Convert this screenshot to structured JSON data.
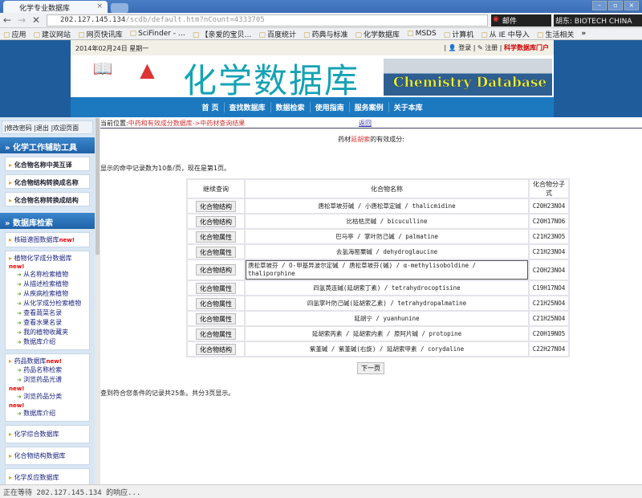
{
  "browser": {
    "tab_title": "化学专业数据库",
    "url_host": "202.127.145.134",
    "url_path": "/scdb/default.htm?nCount=4333705",
    "ext1": "邮件",
    "ext2": "胡东: BIOTECH CHINA",
    "bookmarks": [
      "应用",
      "建议网站",
      "网页快讯库",
      "SciFinder - …",
      "【亲爱的宝贝…",
      "百度统计",
      "药典与标准",
      "化学数据库",
      "MSDS",
      "计算机",
      "从 IE 中导入",
      "生活相关"
    ],
    "more": "»"
  },
  "header": {
    "date": "2014年02月24日 星期一",
    "login": "登录",
    "register": "注册",
    "portal": "科学数据库门户",
    "title": "化学数据库",
    "title_en": "Chemistry Database",
    "nav": [
      "首 页",
      "查找数据库",
      "数据检索",
      "使用指南",
      "服务案例",
      "关于本库"
    ]
  },
  "sidebar": {
    "account": "|修改密码  |退出  |欢迎页面",
    "tools_title": "» 化学工作辅助工具",
    "tools": [
      "化合物名称中英互译",
      "化合物结构转换成名称",
      "化合物名称转换成结构"
    ],
    "db_title": "» 数据库检索",
    "new": "new!",
    "spectra": "核磁谱图数据库",
    "plant": {
      "title": "植物化学成分数据库",
      "items": [
        "从名称检索植物",
        "从描述检索植物",
        "从疾病检索植物",
        "从化学成分检索植物",
        "查看蔬菜名录",
        "查看水果名录",
        "我的植物收藏夹",
        "数据库介绍"
      ]
    },
    "drug": {
      "title": "药品数据库",
      "items": [
        "药品名称检索",
        "浏览药品光谱",
        "浏览药品分类",
        "数据库介绍"
      ]
    },
    "others": [
      "化学综合数据库",
      "化合物结构数据库",
      "化学反应数据库"
    ]
  },
  "main": {
    "crumb_label": "当前位置:",
    "crumb_path": "中药和有效成分数据库->中药材查询结果",
    "back": "返回",
    "subtitle_pre": "药材",
    "herb": "延胡索",
    "subtitle_post": "的有效成分:",
    "page_info": "显示的命中记录数为10条/页，现在是第1页。",
    "columns": [
      "继续查询",
      "化合物名称",
      "化合物分子式"
    ],
    "rows": [
      {
        "btn": "化合物结构",
        "name": "唐松草坡芬碱 / 小唐松草定碱 / thalicmidine",
        "formula": "C20H23NO4"
      },
      {
        "btn": "化合物结构",
        "name": "比枯枯灵碱 / bicuculline",
        "formula": "C20H17NO6"
      },
      {
        "btn": "化合物属性",
        "name": "巴马亭 / 掌叶防己碱 / palmatine",
        "formula": "C21H23NO5"
      },
      {
        "btn": "化合物属性",
        "name": "去氢海罂粟碱 / dehydroglaucine",
        "formula": "C21H23NO4"
      },
      {
        "btn": "化合物结构",
        "name": "唐松草坡芬 / O-甲基异波尔定碱 / 唐松草坡芬(碱) / α-methylisoboldine / thaliporphine",
        "formula": "C20H23NO4"
      },
      {
        "btn": "化合物属性",
        "name": "四氢黄连碱(延胡索丁素) / tetrahydrocoptisine",
        "formula": "C19H17NO4"
      },
      {
        "btn": "化合物属性",
        "name": "四氢掌叶防己碱(延胡索乙素) / tetrahydropalmatine",
        "formula": "C21H25NO4"
      },
      {
        "btn": "化合物属性",
        "name": "延胡宁 / yuanhunine",
        "formula": "C21H25NO4"
      },
      {
        "btn": "化合物属性",
        "name": "延胡索丙素 / 延胡索内素 / 原阿片碱 / protopine",
        "formula": "C20H19NO5"
      },
      {
        "btn": "化合物结构",
        "name": "紫堇碱 / 紫堇碱(右旋) / 延胡索甲素 / corydaline",
        "formula": "C22H27NO4"
      }
    ],
    "next": "下一页",
    "total": "查到符合您条件的记录共25条。共分3页显示。"
  },
  "status": "正在等待 202.127.145.134 的响应..."
}
